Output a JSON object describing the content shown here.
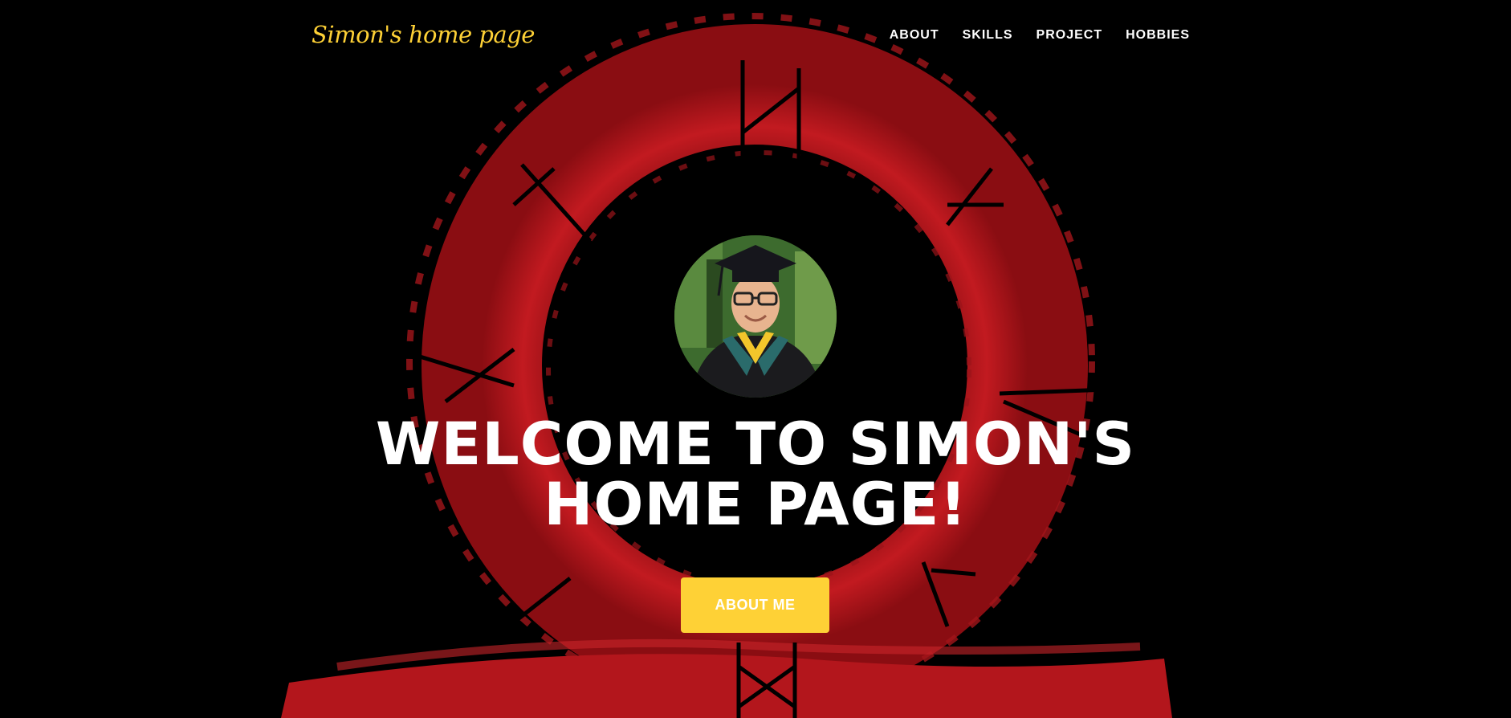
{
  "brand": {
    "name": "Simon's home page"
  },
  "nav": {
    "items": [
      {
        "label": "ABOUT"
      },
      {
        "label": "SKILLS"
      },
      {
        "label": "PROJECT"
      },
      {
        "label": "HOBBIES"
      }
    ]
  },
  "hero": {
    "title_line1": "WELCOME TO SIMON'S",
    "title_line2": "HOME PAGE!",
    "cta_label": "ABOUT ME",
    "avatar_alt": "Portrait photo"
  },
  "colors": {
    "accent": "#fed136",
    "background": "#000000",
    "ring_red": "#b3161c",
    "text": "#ffffff"
  },
  "icons": {
    "background_art": "red-brush-ring-emblem"
  }
}
